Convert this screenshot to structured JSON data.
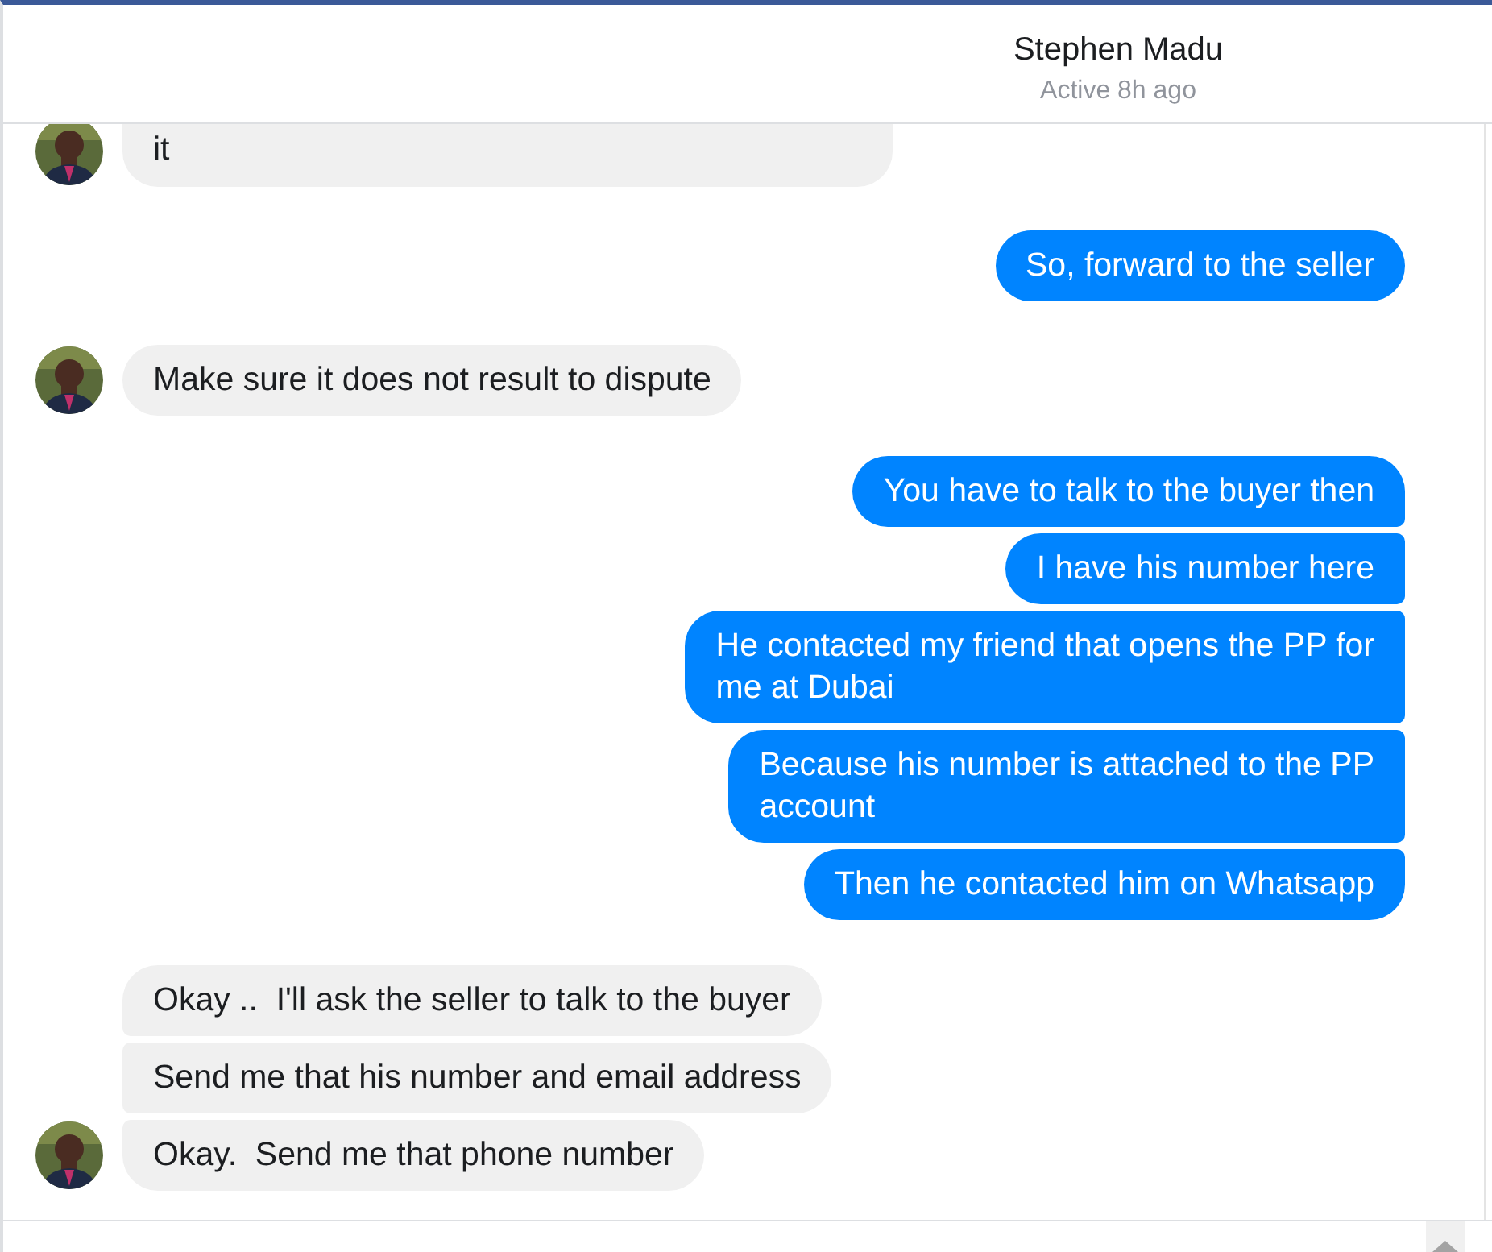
{
  "header": {
    "name": "Stephen Madu",
    "status": "Active 8h ago"
  },
  "groups": [
    {
      "kind": "them",
      "messages": [
        "it"
      ],
      "cut": true
    },
    {
      "kind": "me",
      "messages": [
        "So, forward to the seller"
      ]
    },
    {
      "kind": "them",
      "messages": [
        "Make sure it does not result to dispute"
      ]
    },
    {
      "kind": "me",
      "messages": [
        "You have to talk to the buyer then",
        "I have his number here",
        "He contacted my friend that opens the PP for\nme at Dubai",
        "Because his number is attached to the PP\naccount",
        "Then he contacted him on Whatsapp"
      ]
    },
    {
      "kind": "them",
      "messages": [
        "Okay ..  I'll ask the seller to talk to the buyer",
        "Send me that his number and email address",
        "Okay.  Send me that phone number"
      ]
    }
  ]
}
